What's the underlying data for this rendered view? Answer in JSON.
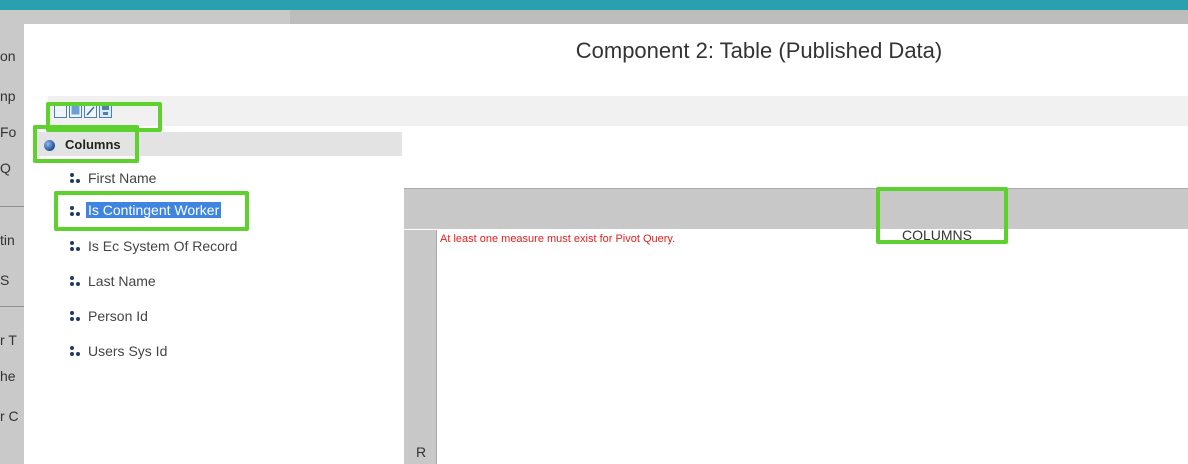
{
  "dialog": {
    "title": "Component 2: Table (Published Data)"
  },
  "toolbar": {
    "buttons": [
      "new-document-icon",
      "database-icon",
      "edit-icon",
      "save-icon"
    ]
  },
  "tree": {
    "header": "Columns",
    "items": [
      {
        "label": "First Name",
        "selected": false
      },
      {
        "label": "Is Contingent Worker",
        "selected": true
      },
      {
        "label": "Is Ec System Of Record",
        "selected": false
      },
      {
        "label": "Last Name",
        "selected": false
      },
      {
        "label": "Person Id",
        "selected": false
      },
      {
        "label": "Users Sys Id",
        "selected": false
      }
    ]
  },
  "pivot": {
    "columns_label": "COLUMNS",
    "rows_label": "R",
    "error_message": "At least one measure must exist for Pivot Query."
  },
  "colors": {
    "highlight": "#5fd12e",
    "selection": "#3f85e0",
    "error": "#e02020",
    "accent_bar": "#2a9fb0"
  }
}
